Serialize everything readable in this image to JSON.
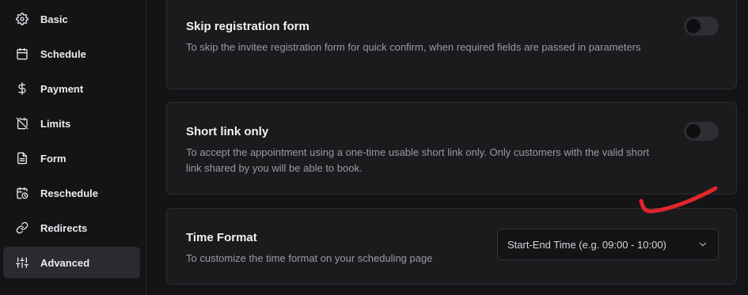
{
  "sidebar": {
    "items": [
      {
        "label": "Basic",
        "icon": "gear-icon",
        "active": false
      },
      {
        "label": "Schedule",
        "icon": "calendar-icon",
        "active": false
      },
      {
        "label": "Payment",
        "icon": "dollar-icon",
        "active": false
      },
      {
        "label": "Limits",
        "icon": "calendar-off-icon",
        "active": false
      },
      {
        "label": "Form",
        "icon": "document-icon",
        "active": false
      },
      {
        "label": "Reschedule",
        "icon": "calendar-clock-icon",
        "active": false
      },
      {
        "label": "Redirects",
        "icon": "link-icon",
        "active": false
      },
      {
        "label": "Advanced",
        "icon": "sliders-icon",
        "active": true
      }
    ]
  },
  "settings": {
    "skip_registration": {
      "title": "Skip registration form",
      "description": "To skip the invitee registration form for quick confirm, when required fields are passed in parameters",
      "enabled": false
    },
    "short_link_only": {
      "title": "Short link only",
      "description": "To accept the appointment using a one-time usable short link only. Only customers with the valid short link shared by you will be able to book.",
      "enabled": false
    },
    "time_format": {
      "title": "Time Format",
      "description": "To customize the time format on your scheduling page",
      "selected": "Start-End Time (e.g. 09:00 - 10:00)"
    }
  },
  "colors": {
    "annotation": "#e0262b"
  }
}
